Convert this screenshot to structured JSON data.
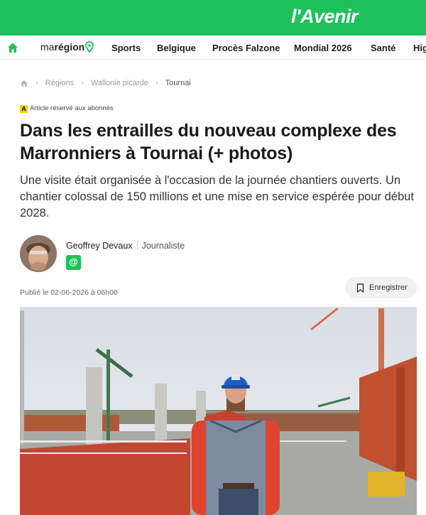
{
  "brand": {
    "logo_text": "l'Avenir",
    "accent_color": "#1ec15c"
  },
  "nav": {
    "home_icon": "home-icon",
    "region_prefix": "ma",
    "region_label": "région",
    "region_icon": "location-pin-icon",
    "items": [
      "Sports",
      "Belgique",
      "Procès Falzone",
      "Mondial 2026",
      "Santé",
      "Hig"
    ]
  },
  "breadcrumb": {
    "home_icon": "home-icon",
    "items": [
      "Régions",
      "Wallonie picarde",
      "Tournai"
    ]
  },
  "article": {
    "premium_badge": "A",
    "premium_label": "Article réservé aux abonnés",
    "title": "Dans les entrailles du nouveau complexe des Marronniers à Tournai (+ photos)",
    "chapo": "Une visite était organisée à l'occasion de la journée chantiers ouverts. Un chantier colossal de 150 millions et une mise en service espérée pour début 2028.",
    "author_name": "Geoffrey Devaux",
    "author_role": "Journaliste",
    "contact_icon": "at-sign-icon",
    "contact_label": "@",
    "published": "Publié le 02-06-2026 à 06h00",
    "save_icon": "bookmark-icon",
    "save_label": "Enregistrer"
  }
}
